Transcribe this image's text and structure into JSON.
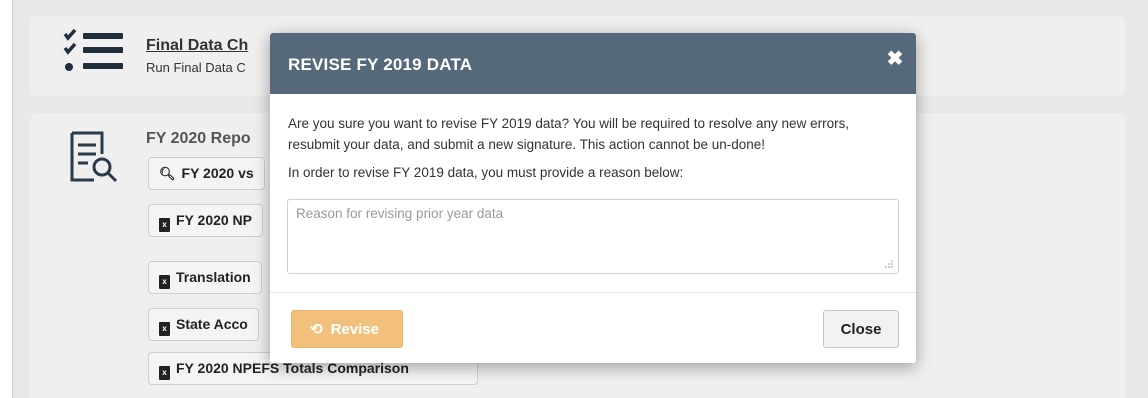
{
  "background": {
    "final_card": {
      "title": "Final Data Ch",
      "subtitle": "Run Final Data C",
      "icon": "checklist-icon"
    },
    "report_card": {
      "title": "FY 2020 Repo",
      "icon": "report-search-icon",
      "buttons": [
        {
          "label": "FY 2020 vs",
          "icon": "search-icon"
        },
        {
          "label": "FY 2020 NP",
          "icon": "excel-file-icon"
        },
        {
          "label": "Translation",
          "icon": "excel-file-icon"
        },
        {
          "label": "State Acco",
          "icon": "excel-file-icon"
        },
        {
          "label": "FY 2020 NPEFS Totals Comparison",
          "icon": "excel-file-icon"
        }
      ]
    }
  },
  "modal": {
    "title": "REVISE FY 2019 DATA",
    "close_icon": "close-icon",
    "confirm_text": "Are you sure you want to revise FY 2019 data? You will be required to resolve any new errors, resubmit your data, and submit a new signature. This action cannot be un-done!",
    "instruction_text": "In order to revise FY 2019 data, you must provide a reason below:",
    "reason_field": {
      "value": "",
      "placeholder": "Reason for revising prior year data"
    },
    "revise_button": {
      "label": "Revise",
      "icon": "undo-icon"
    },
    "close_button": {
      "label": "Close"
    }
  },
  "colors": {
    "modal_header": "#56697a",
    "revise_button": "#f0c07c",
    "backdrop": "#e8e8e8"
  }
}
